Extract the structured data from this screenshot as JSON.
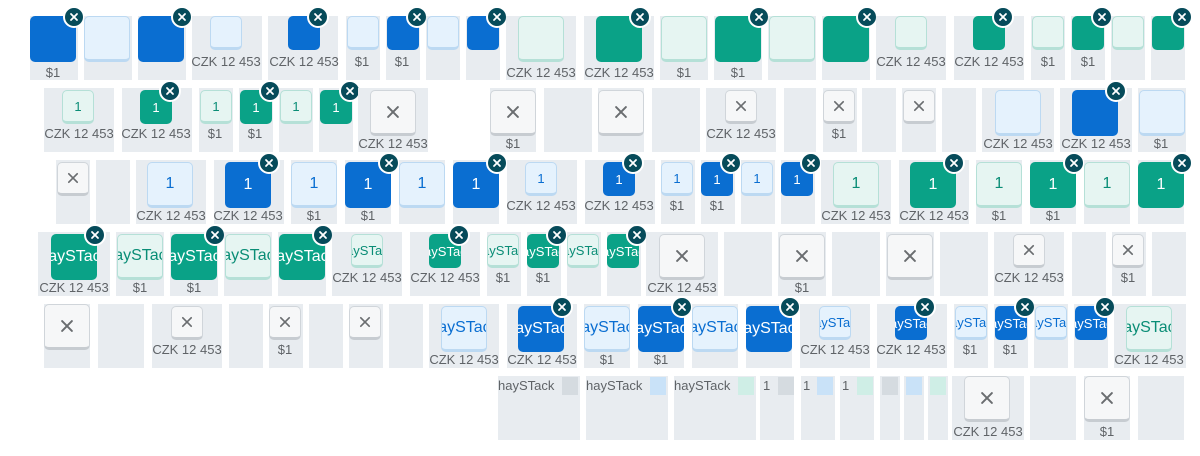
{
  "labels": {
    "price_czk": "CZK 12 453",
    "price_usd": "$1",
    "key_number": "1",
    "key_word": "haySTack"
  },
  "legend": {
    "items": [
      "haySTack",
      "haySTack",
      "haySTack",
      "1",
      "1",
      "1"
    ]
  },
  "icons": {
    "remove": "remove-circle-icon",
    "placeholder": "close-icon"
  },
  "colors": {
    "blue_selected": "#0a6ed1",
    "blue_default": "#e5f2fd",
    "green_selected": "#0aa287",
    "green_default": "#e6f5f2",
    "remove_badge": "#064b5a",
    "cell_background": "#e8ecf0"
  }
}
